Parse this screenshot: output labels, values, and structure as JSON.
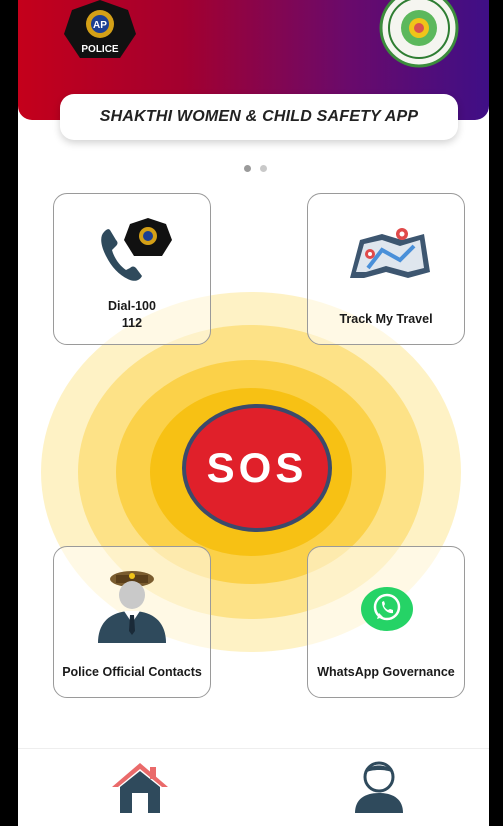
{
  "header": {
    "app_title": "SHAKTHI WOMEN & CHILD SAFETY APP",
    "police_logo_text": "AP",
    "police_logo_caption": "POLICE"
  },
  "carousel": {
    "page_count": 2,
    "active_index": 0
  },
  "sos": {
    "label": "SOS",
    "color": "#e0202a",
    "ring_color": "#f6be0a"
  },
  "cards": [
    {
      "id": "dial",
      "line1": "Dial-100",
      "line2": "112",
      "icon": "phone-police-icon"
    },
    {
      "id": "track",
      "line1": "Track My Travel",
      "icon": "map-pin-icon"
    },
    {
      "id": "police",
      "line1": "Police Official Contacts",
      "icon": "police-officer-icon"
    },
    {
      "id": "whatsapp",
      "line1": "WhatsApp Governance",
      "icon": "whatsapp-icon"
    }
  ],
  "nav": {
    "home_icon": "home-icon",
    "profile_icon": "user-profile-icon"
  },
  "colors": {
    "banner_start": "#c4001b",
    "banner_end": "#3f0f86",
    "whatsapp": "#25d366",
    "nav_icon": "#2f4a5c",
    "home_roof": "#ea6a6a"
  }
}
